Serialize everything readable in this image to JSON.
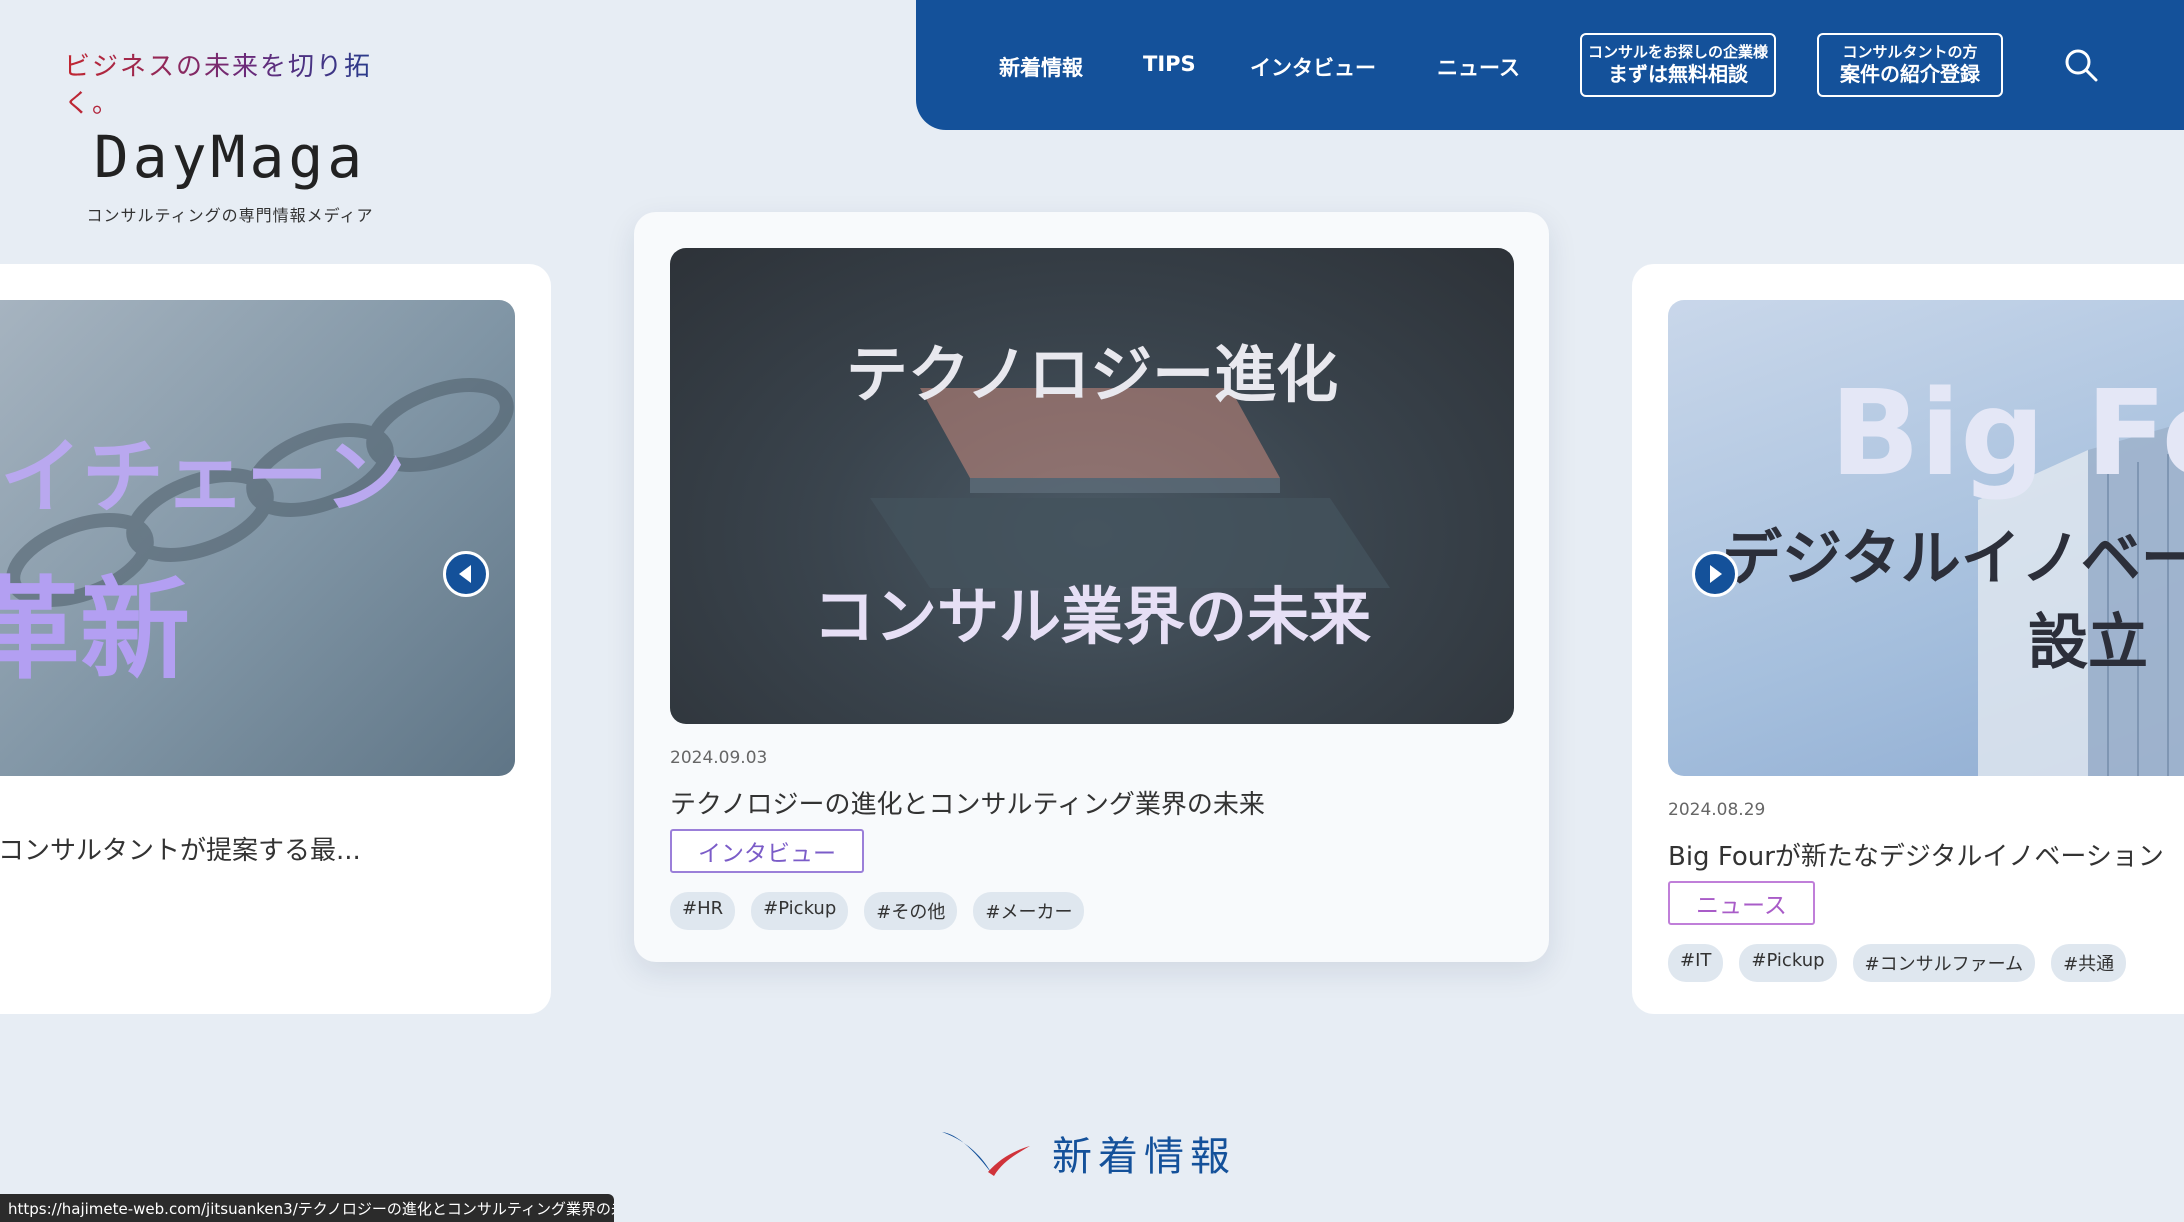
{
  "logo": {
    "tagline": "ビジネスの未来を切り拓く。",
    "name": "DayMaga",
    "subtitle": "コンサルティングの専門情報メディア"
  },
  "nav": {
    "items": [
      "新着情報",
      "TIPS",
      "インタビュー",
      "ニュース"
    ],
    "btn_company_small": "コンサルをお探しの企業様",
    "btn_company_big": "まずは無料相談",
    "btn_consultant_small": "コンサルタントの方",
    "btn_consultant_big": "案件の紹介登録",
    "search_icon": "search-icon",
    "bg_color": "#14519a"
  },
  "cards": {
    "left": {
      "thumb_text_1": "イチェーン",
      "thumb_text_2": "革新",
      "title": "コンサルタントが提案する最..."
    },
    "center": {
      "thumb_text_1": "テクノロジー進化",
      "thumb_text_2": "コンサル業界の未来",
      "date": "2024.09.03",
      "title": "テクノロジーの進化とコンサルティング業界の未来",
      "category": "インタビュー",
      "tags": [
        "#HR",
        "#Pickup",
        "#その他",
        "#メーカー"
      ]
    },
    "right": {
      "thumb_text_1": "Big Fo",
      "thumb_text_2": "デジタルイノベー",
      "thumb_text_3": "設立",
      "date": "2024.08.29",
      "title": "Big Fourが新たなデジタルイノベーション",
      "category": "ニュース",
      "tags": [
        "#IT",
        "#Pickup",
        "#コンサルファーム",
        "#共通"
      ]
    }
  },
  "section": {
    "title": "新着情報"
  },
  "statusbar": {
    "url": "https://hajimete-web.com/jitsuanken3/テクノロジーの進化とコンサルティング業界の未/"
  }
}
